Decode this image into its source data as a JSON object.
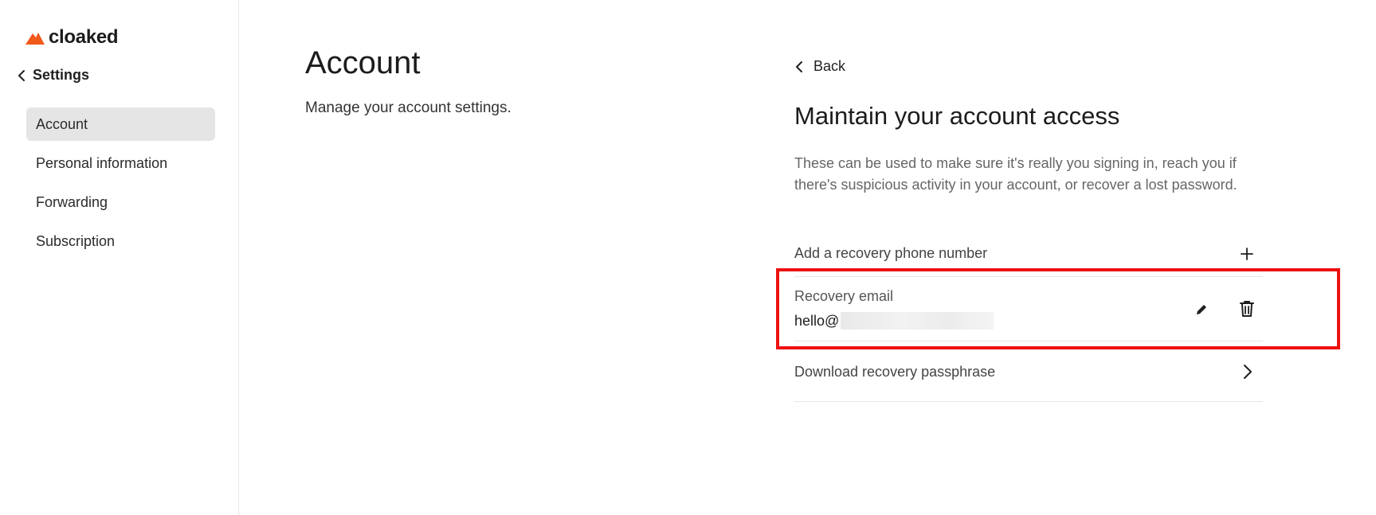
{
  "brand": {
    "name": "cloaked",
    "accent_color": "#f05a1a"
  },
  "sidebar": {
    "back_label": "Settings",
    "items": [
      {
        "label": "Account",
        "active": true
      },
      {
        "label": "Personal information",
        "active": false
      },
      {
        "label": "Forwarding",
        "active": false
      },
      {
        "label": "Subscription",
        "active": false
      }
    ]
  },
  "main": {
    "title": "Account",
    "subtitle": "Manage your account settings."
  },
  "panel": {
    "back_label": "Back",
    "title": "Maintain your account access",
    "description": "These can be used to make sure it's really you signing in, reach you if there's suspicious activity in your account, or recover a lost password.",
    "phone_row": {
      "label": "Add a recovery phone number",
      "icon": "plus-icon"
    },
    "email_row": {
      "label": "Recovery email",
      "value_visible": "hello@",
      "edit_icon": "pencil-icon",
      "delete_icon": "trash-icon"
    },
    "download_row": {
      "label": "Download recovery passphrase",
      "icon": "chevron-right-icon"
    }
  },
  "annotation": {
    "highlight_color": "#ee1111"
  }
}
